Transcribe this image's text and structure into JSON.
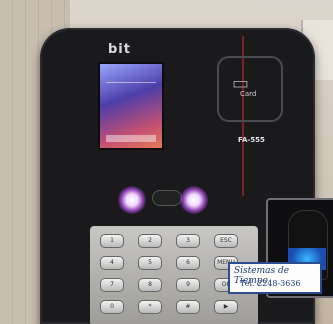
{
  "image": {
    "alt": "",
    "brand_text": "bit",
    "card_reader_label": "Card",
    "model_label": "FA-555",
    "sticker": {
      "line1": "Sistemas de Tiempo",
      "line2": "Tel. 2248-3636"
    },
    "key_labels": [
      [
        "1",
        "2",
        "3",
        "ESC"
      ],
      [
        "4",
        "5",
        "6",
        "MENU"
      ],
      [
        "7",
        "8",
        "9",
        "OK"
      ],
      [
        "0",
        "*",
        "#",
        "▶"
      ]
    ]
  }
}
